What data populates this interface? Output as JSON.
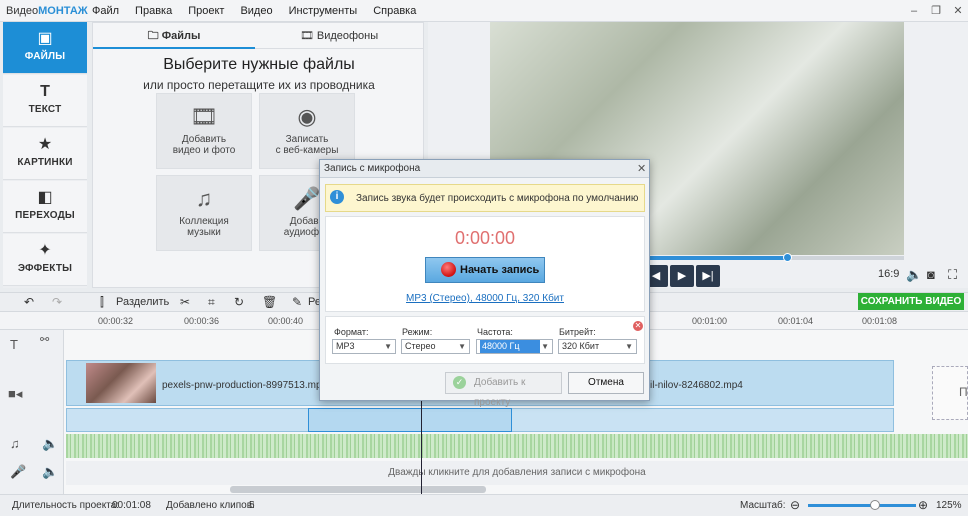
{
  "app": {
    "logo_prefix": "Видео",
    "logo_suffix": "МОНТАЖ"
  },
  "menu": [
    "Файл",
    "Правка",
    "Проект",
    "Видео",
    "Инструменты",
    "Справка"
  ],
  "nav": [
    {
      "label": "ФАЙЛЫ",
      "icon": "image-icon"
    },
    {
      "label": "ТЕКСТ",
      "icon": "text-icon"
    },
    {
      "label": "КАРТИНКИ",
      "icon": "star-icon"
    },
    {
      "label": "ПЕРЕХОДЫ",
      "icon": "transitions-icon"
    },
    {
      "label": "ЭФФЕКТЫ",
      "icon": "magic-wand-icon"
    }
  ],
  "files_panel": {
    "tabs": [
      "Файлы",
      "Видеофоны"
    ],
    "heading": "Выберите нужные файлы",
    "subheading": "или просто перетащите их из проводника",
    "tiles": [
      {
        "label1": "Добавить",
        "label2": "видео и фото"
      },
      {
        "label1": "Записать",
        "label2": "с веб-камеры"
      },
      {
        "label1": "Коллекция",
        "label2": "музыки"
      },
      {
        "label1": "Добави",
        "label2": "аудиофай"
      }
    ]
  },
  "player": {
    "ratio": "16:9",
    "progress": 0.72
  },
  "toolbar": {
    "split": "Разделить",
    "edit_partial": "Ре",
    "save": "СОХРАНИТЬ ВИДЕО"
  },
  "ruler": [
    "00:00:32",
    "00:00:36",
    "00:00:40",
    "00:01:00",
    "00:01:04",
    "00:01:08"
  ],
  "timeline": {
    "clip1": "pexels-pnw-production-8997513.mp",
    "clip2": "il-nilov-8246802.mp4",
    "mic_hint": "Дважды кликните для добавления записи с микрофона",
    "placeholder": "П"
  },
  "status": {
    "duration_label": "Длительность проекта:",
    "duration": "00:01:08",
    "clips_label": "Добавлено клипов:",
    "clips": "5",
    "zoom_label": "Масштаб:",
    "zoom": "125%"
  },
  "dialog": {
    "title": "Запись с микрофона",
    "info": "Запись звука будет происходить с микрофона по умолчанию",
    "timer": "0:00:00",
    "start": "Начать запись",
    "format_link": "MP3 (Стерео), 48000 Гц, 320 Кбит",
    "labels": {
      "format": "Формат:",
      "mode": "Режим:",
      "freq": "Частота:",
      "bitrate": "Битрейт:"
    },
    "values": {
      "format": "MP3",
      "mode": "Стерео",
      "freq": "48000 Гц",
      "bitrate": "320 Кбит"
    },
    "add": "Добавить к проекту",
    "cancel": "Отмена"
  }
}
